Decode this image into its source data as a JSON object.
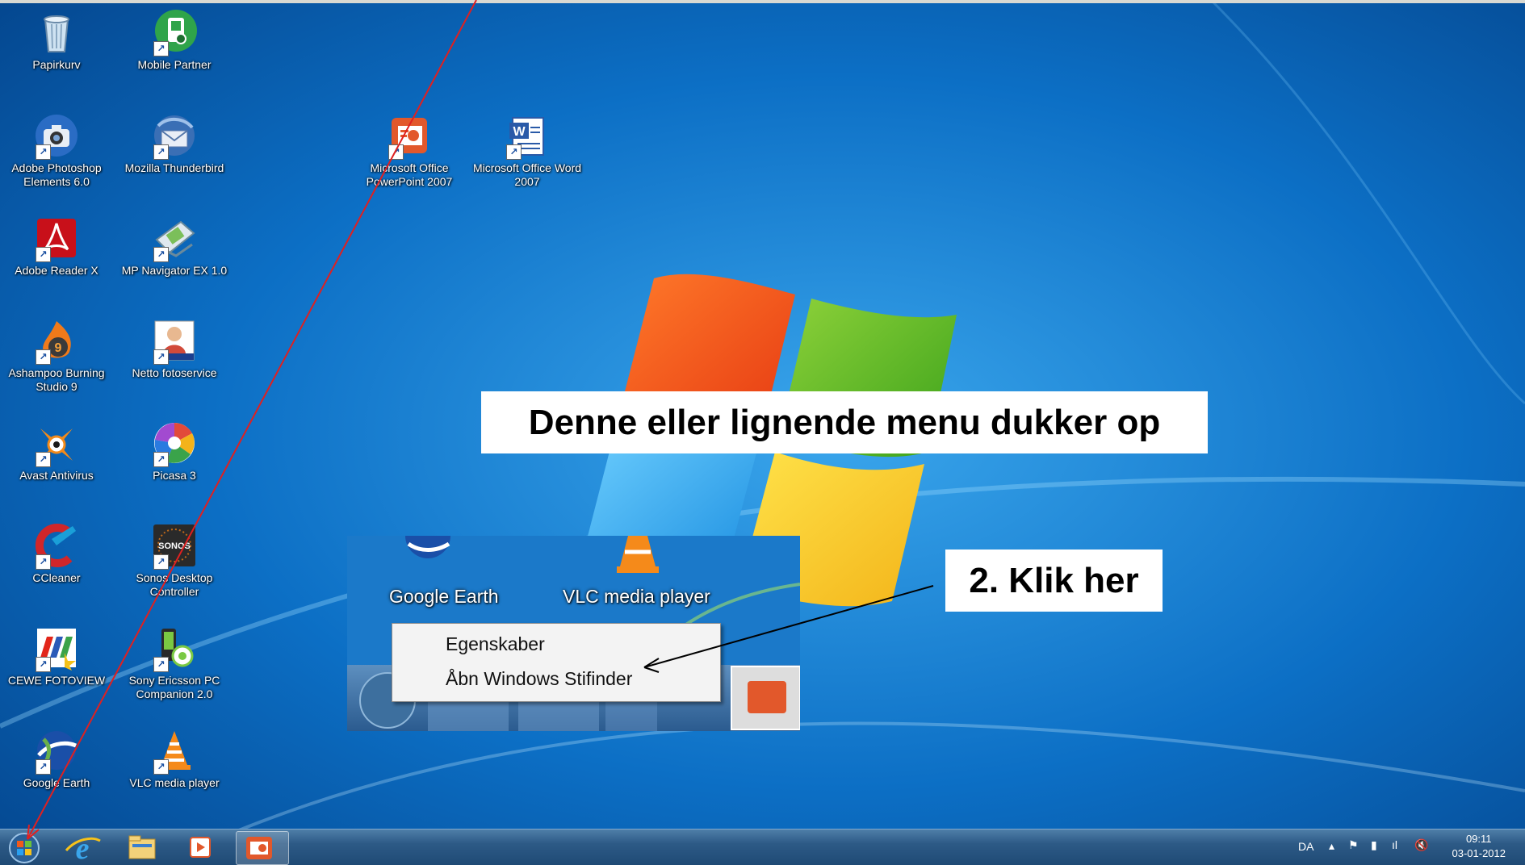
{
  "desktop_icons": [
    {
      "label": "Papirkurv",
      "icon": "recycle-bin-icon"
    },
    {
      "label": "Mobile Partner",
      "icon": "mobile-partner-icon"
    },
    {
      "label": "Adobe Photoshop Elements 6.0",
      "icon": "photoshop-elements-icon"
    },
    {
      "label": "Mozilla Thunderbird",
      "icon": "thunderbird-icon"
    },
    {
      "label": "Microsoft Office PowerPoint 2007",
      "icon": "powerpoint-icon"
    },
    {
      "label": "Microsoft Office Word 2007",
      "icon": "word-icon"
    },
    {
      "label": "Adobe Reader X",
      "icon": "adobe-reader-icon"
    },
    {
      "label": "MP Navigator EX 1.0",
      "icon": "mp-navigator-icon"
    },
    {
      "label": "Ashampoo Burning Studio 9",
      "icon": "ashampoo-icon"
    },
    {
      "label": "Netto fotoservice",
      "icon": "netto-fotoservice-icon"
    },
    {
      "label": "Avast Antivirus",
      "icon": "avast-icon"
    },
    {
      "label": "Picasa 3",
      "icon": "picasa-icon"
    },
    {
      "label": "CCleaner",
      "icon": "ccleaner-icon"
    },
    {
      "label": "Sonos Desktop Controller",
      "icon": "sonos-icon"
    },
    {
      "label": "CEWE FOTOVIEW",
      "icon": "cewe-icon"
    },
    {
      "label": "Sony Ericsson PC Companion 2.0",
      "icon": "sony-ericsson-icon"
    },
    {
      "label": "Google Earth",
      "icon": "google-earth-icon"
    },
    {
      "label": "VLC media player",
      "icon": "vlc-icon"
    }
  ],
  "callouts": {
    "menu_note": "Denne eller lignende menu dukker op",
    "step2": "2. Klik her"
  },
  "inset": {
    "google_earth_label": "Google Earth",
    "vlc_label": "VLC media player",
    "context_menu": {
      "item1": "Egenskaber",
      "item2": "Åbn Windows Stifinder"
    }
  },
  "taskbar": {
    "pinned": [
      "start-orb-icon",
      "internet-explorer-icon",
      "windows-explorer-icon",
      "media-player-icon",
      "powerpoint-icon"
    ],
    "tray": {
      "language": "DA",
      "time": "09:11",
      "date": "03-01-2012"
    }
  },
  "colors": {
    "annotation_red": "#e02020",
    "wallpaper_blue": "#0a6fc4"
  }
}
